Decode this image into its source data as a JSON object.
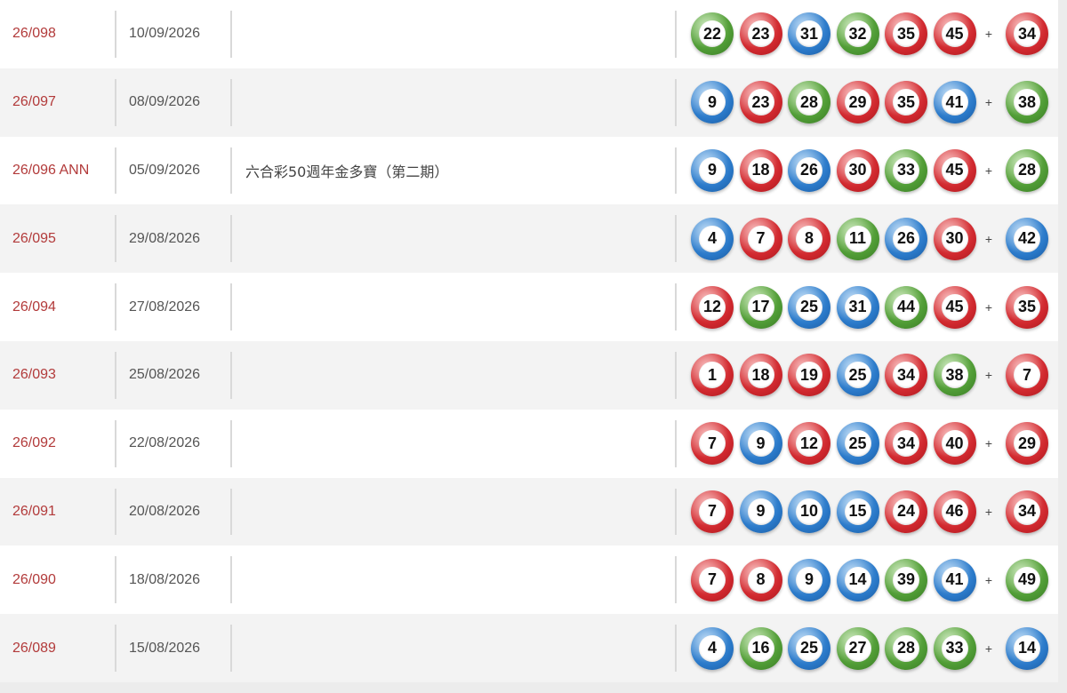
{
  "rows": [
    {
      "draw": "26/098",
      "date": "10/09/2026",
      "note": "",
      "numbers": [
        "22",
        "23",
        "31",
        "32",
        "35",
        "45"
      ],
      "colors": [
        "green",
        "red",
        "blue",
        "green",
        "red",
        "red"
      ],
      "plus": "+",
      "special": "34",
      "special_color": "red"
    },
    {
      "draw": "26/097",
      "date": "08/09/2026",
      "note": "",
      "numbers": [
        "9",
        "23",
        "28",
        "29",
        "35",
        "41"
      ],
      "colors": [
        "blue",
        "red",
        "green",
        "red",
        "red",
        "blue"
      ],
      "plus": "+",
      "special": "38",
      "special_color": "green"
    },
    {
      "draw": "26/096 ANN",
      "date": "05/09/2026",
      "note": "六合彩50週年金多寶（第二期）",
      "numbers": [
        "9",
        "18",
        "26",
        "30",
        "33",
        "45"
      ],
      "colors": [
        "blue",
        "red",
        "blue",
        "red",
        "green",
        "red"
      ],
      "plus": "+",
      "special": "28",
      "special_color": "green"
    },
    {
      "draw": "26/095",
      "date": "29/08/2026",
      "note": "",
      "numbers": [
        "4",
        "7",
        "8",
        "11",
        "26",
        "30"
      ],
      "colors": [
        "blue",
        "red",
        "red",
        "green",
        "blue",
        "red"
      ],
      "plus": "+",
      "special": "42",
      "special_color": "blue"
    },
    {
      "draw": "26/094",
      "date": "27/08/2026",
      "note": "",
      "numbers": [
        "12",
        "17",
        "25",
        "31",
        "44",
        "45"
      ],
      "colors": [
        "red",
        "green",
        "blue",
        "blue",
        "green",
        "red"
      ],
      "plus": "+",
      "special": "35",
      "special_color": "red"
    },
    {
      "draw": "26/093",
      "date": "25/08/2026",
      "note": "",
      "numbers": [
        "1",
        "18",
        "19",
        "25",
        "34",
        "38"
      ],
      "colors": [
        "red",
        "red",
        "red",
        "blue",
        "red",
        "green"
      ],
      "plus": "+",
      "special": "7",
      "special_color": "red"
    },
    {
      "draw": "26/092",
      "date": "22/08/2026",
      "note": "",
      "numbers": [
        "7",
        "9",
        "12",
        "25",
        "34",
        "40"
      ],
      "colors": [
        "red",
        "blue",
        "red",
        "blue",
        "red",
        "red"
      ],
      "plus": "+",
      "special": "29",
      "special_color": "red"
    },
    {
      "draw": "26/091",
      "date": "20/08/2026",
      "note": "",
      "numbers": [
        "7",
        "9",
        "10",
        "15",
        "24",
        "46"
      ],
      "colors": [
        "red",
        "blue",
        "blue",
        "blue",
        "red",
        "red"
      ],
      "plus": "+",
      "special": "34",
      "special_color": "red"
    },
    {
      "draw": "26/090",
      "date": "18/08/2026",
      "note": "",
      "numbers": [
        "7",
        "8",
        "9",
        "14",
        "39",
        "41"
      ],
      "colors": [
        "red",
        "red",
        "blue",
        "blue",
        "green",
        "blue"
      ],
      "plus": "+",
      "special": "49",
      "special_color": "green"
    },
    {
      "draw": "26/089",
      "date": "15/08/2026",
      "note": "",
      "numbers": [
        "4",
        "16",
        "25",
        "27",
        "28",
        "33"
      ],
      "colors": [
        "blue",
        "green",
        "blue",
        "green",
        "green",
        "green"
      ],
      "plus": "+",
      "special": "14",
      "special_color": "blue"
    }
  ]
}
